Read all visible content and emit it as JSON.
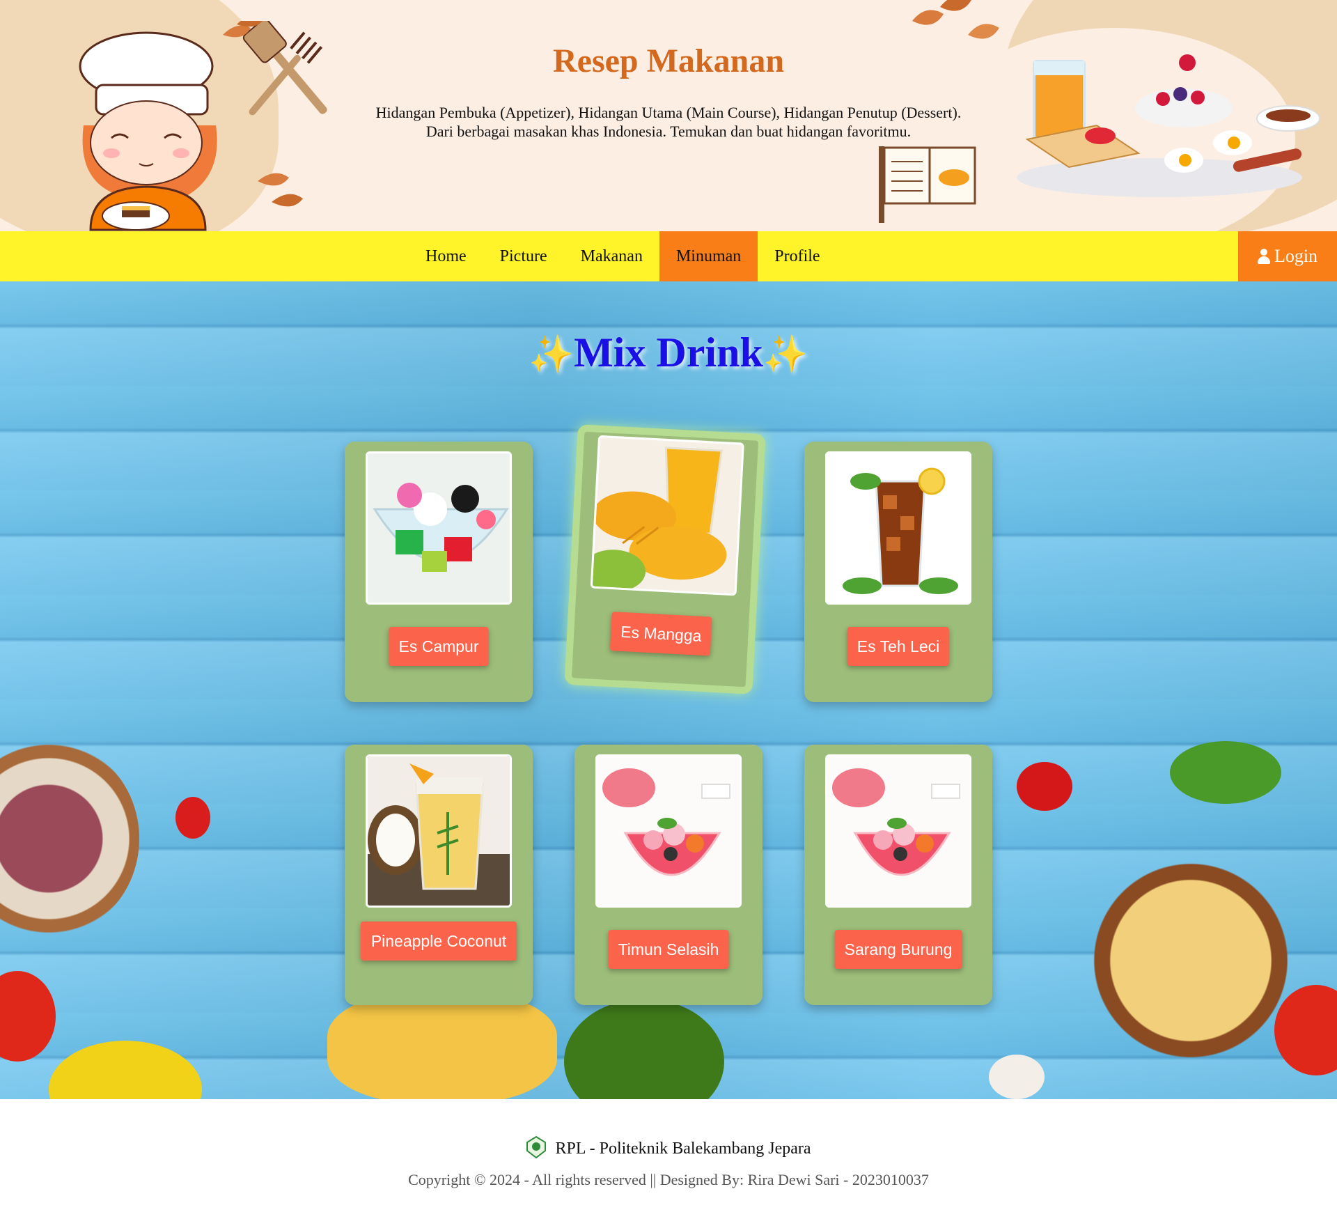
{
  "header": {
    "title": "Resep Makanan",
    "desc_line1": "Hidangan Pembuka (Appetizer), Hidangan Utama (Main Course), Hidangan Penutup (Dessert).",
    "desc_line2": "Dari berbagai masakan khas Indonesia. Temukan dan buat hidangan favoritmu."
  },
  "nav": {
    "items": [
      {
        "label": "Home"
      },
      {
        "label": "Picture"
      },
      {
        "label": "Makanan"
      },
      {
        "label": "Minuman",
        "active": true
      },
      {
        "label": "Profile"
      }
    ],
    "login_label": "Login",
    "login_icon": "user-icon"
  },
  "main": {
    "title": "Mix Drink",
    "sparkle": "✨",
    "cards": [
      {
        "label": "Es Campur"
      },
      {
        "label": "Es Mangga"
      },
      {
        "label": "Es Teh Leci"
      },
      {
        "label": "Pineapple Coconut"
      },
      {
        "label": "Timun Selasih"
      },
      {
        "label": "Sarang Burung"
      }
    ]
  },
  "footer": {
    "org": "RPL - Politeknik Balekambang Jepara",
    "copyright": "Copyright © 2024 - All rights reserved || Designed By: Rira Dewi Sari - 2023010037"
  },
  "colors": {
    "nav_bg": "#fff42a",
    "accent_orange": "#fa7e17",
    "title_brown": "#d2691e",
    "section_title_blue": "#1a10e6",
    "card_green": "#9dbd7a",
    "label_red": "#fb634a"
  }
}
